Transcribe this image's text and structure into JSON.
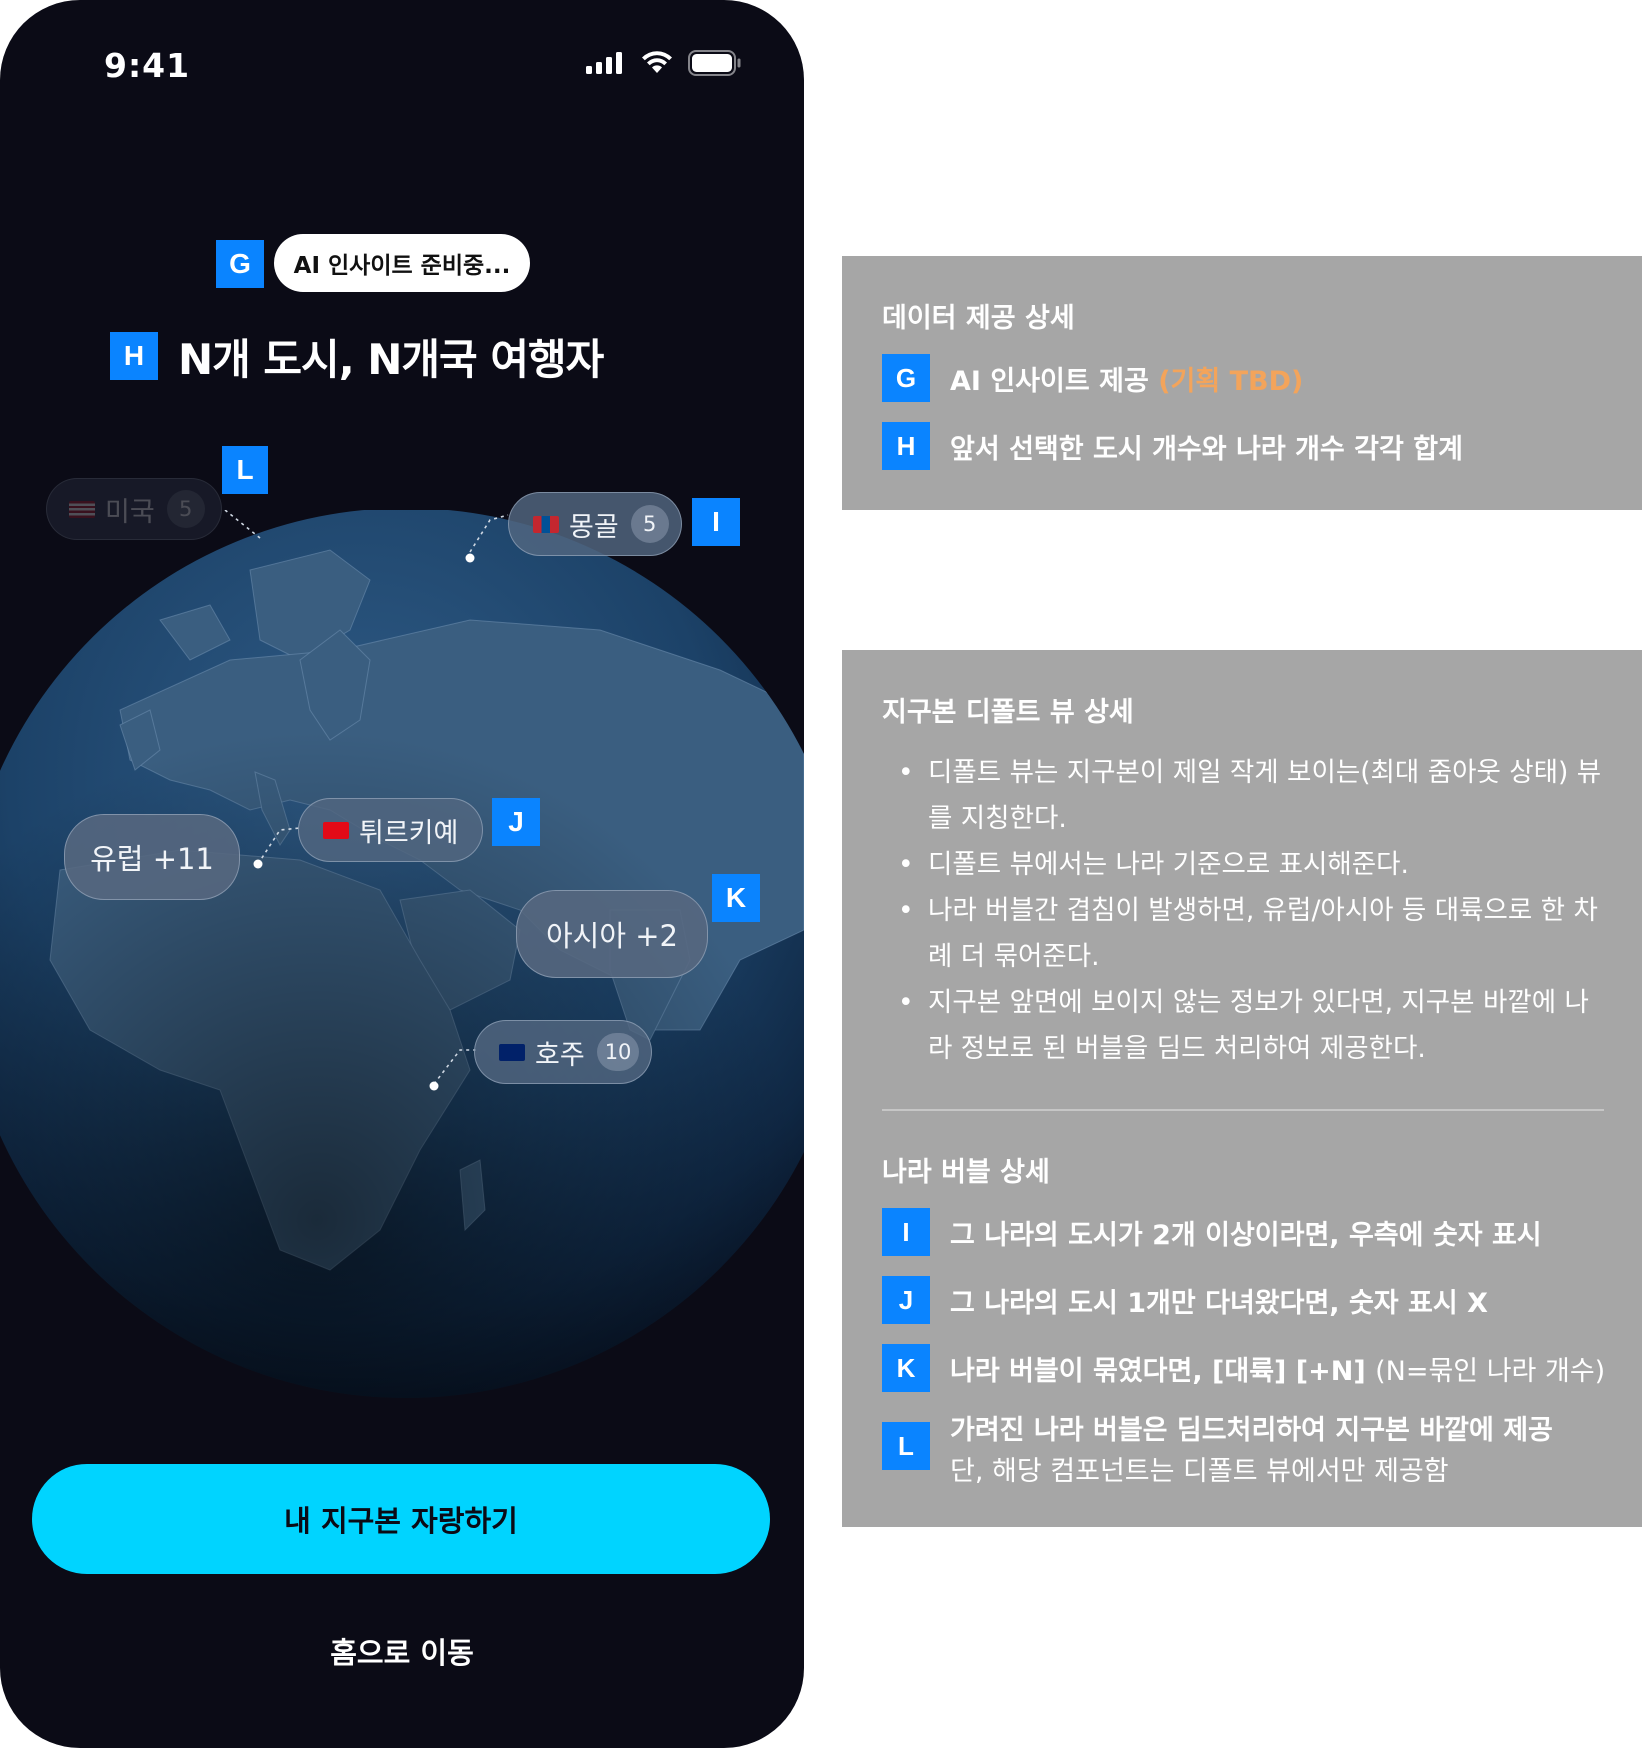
{
  "status_bar": {
    "time": "9:41"
  },
  "markers": {
    "G": "G",
    "H": "H",
    "I": "I",
    "J": "J",
    "K": "K",
    "L": "L"
  },
  "ai_pill": {
    "label": "AI 인사이트 준비중..."
  },
  "headline": "N개 도시, N개국 여행자",
  "bubbles": {
    "usa": {
      "label": "미국",
      "count": "5"
    },
    "mongolia": {
      "label": "몽골",
      "count": "5"
    },
    "turkey": {
      "label": "튀르키예"
    },
    "australia": {
      "label": "호주",
      "count": "10"
    },
    "europe": {
      "label": "유럽 +11"
    },
    "asia": {
      "label": "아시아 +2"
    }
  },
  "cta": {
    "label": "내 지구본 자랑하기"
  },
  "home_link": {
    "label": "홈으로 이동"
  },
  "panel_data": {
    "title": "데이터 제공 상세",
    "g": {
      "text": "AI 인사이트 제공",
      "tbd": "(기획 TBD)"
    },
    "h": {
      "text": "앞서 선택한 도시 개수와 나라 개수 각각 합계"
    }
  },
  "panel_globe": {
    "title": "지구본 디폴트 뷰 상세",
    "bullets": [
      "디폴트 뷰는 지구본이 제일 작게 보이는(최대 줌아웃 상태) 뷰를 지칭한다.",
      "디폴트 뷰에서는 나라 기준으로 표시해준다.",
      "나라 버블간 겹침이 발생하면, 유럽/아시아 등 대륙으로 한 차례 더 묶어준다.",
      "지구본 앞면에 보이지 않는 정보가 있다면, 지구본 바깥에 나라 정보로 된 버블을 딤드 처리하여 제공한다."
    ]
  },
  "panel_bubble": {
    "title": "나라 버블 상세",
    "i": "그 나라의 도시가 2개 이상이라면, 우측에 숫자 표시",
    "j": "그 나라의 도시 1개만 다녀왔다면, 숫자 표시 X",
    "k": {
      "text": "나라 버블이 묶였다면, [대륙] [+N]",
      "note": "(N=묶인 나라 개수)"
    },
    "l": {
      "text": "가려진 나라 버블은 딤드처리하여 지구본 바깥에 제공",
      "sub": "단, 해당 컴포넌트는 디폴트 뷰에서만 제공함"
    }
  },
  "colors": {
    "accent": "#00d4ff",
    "marker": "#0a84ff",
    "panel": "#a6a6a6",
    "tbd": "#f3a45b",
    "phone_bg": "#0b0b16"
  }
}
